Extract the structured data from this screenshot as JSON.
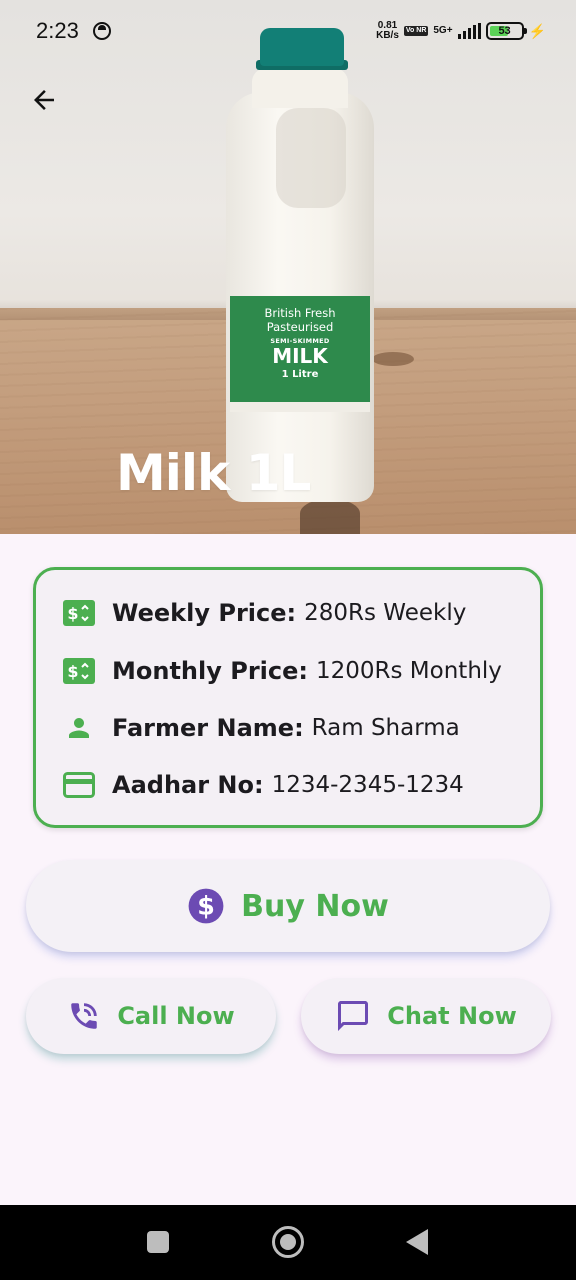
{
  "status_bar": {
    "time": "2:23",
    "speed_value": "0.81",
    "speed_unit": "KB/s",
    "volte_badge": "Vo NR",
    "network": "5G+",
    "battery": "53"
  },
  "product": {
    "title": "Milk 1L",
    "bottle_label": {
      "line1": "British Fresh",
      "line2": "Pasteurised",
      "line3": "SEMI-SKIMMED",
      "line4": "MILK",
      "line5": "1 Litre"
    }
  },
  "details": [
    {
      "key": "Weekly Price:",
      "value": "280Rs Weekly",
      "icon": "price-tag-icon"
    },
    {
      "key": "Monthly Price:",
      "value": "1200Rs Monthly",
      "icon": "price-tag-icon"
    },
    {
      "key": "Farmer Name:",
      "value": "Ram Sharma",
      "icon": "person-icon"
    },
    {
      "key": "Aadhar No:",
      "value": "1234-2345-1234",
      "icon": "card-icon"
    }
  ],
  "actions": {
    "buy": "Buy Now",
    "call": "Call Now",
    "chat": "Chat Now"
  },
  "colors": {
    "accent_green": "#4caf50",
    "icon_purple": "#6c4bb3",
    "background": "#fbf4fb"
  }
}
